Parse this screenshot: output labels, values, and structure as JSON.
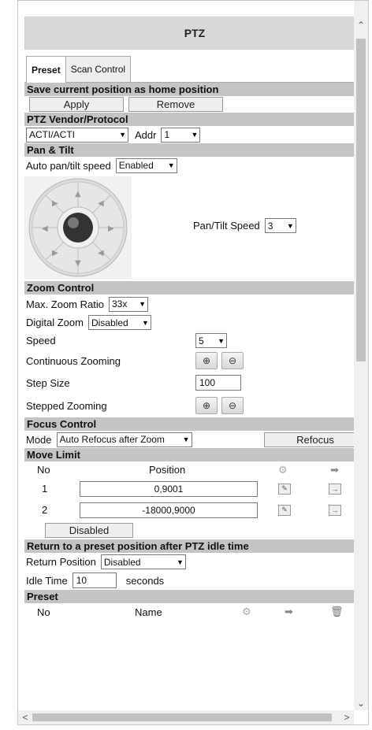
{
  "title": "PTZ",
  "tabs": [
    {
      "label": "Preset"
    },
    {
      "label": "Scan Control"
    }
  ],
  "home": {
    "header": "Save current position as home position",
    "apply": "Apply",
    "remove": "Remove"
  },
  "vendor": {
    "header": "PTZ Vendor/Protocol",
    "protocol": "ACTI/ACTI",
    "addr_label": "Addr",
    "addr": "1"
  },
  "pantilt": {
    "header": "Pan  &  Tilt",
    "auto_label": "Auto pan/tilt speed",
    "auto_value": "Enabled",
    "speed_label": "Pan/Tilt Speed",
    "speed_value": "3"
  },
  "zoom": {
    "header": "Zoom Control",
    "max_label": "Max. Zoom Ratio",
    "max_value": "33x",
    "digital_label": "Digital Zoom",
    "digital_value": "Disabled",
    "speed_label": "Speed",
    "speed_value": "5",
    "continuous_label": "Continuous Zooming",
    "step_label": "Step Size",
    "step_value": "100",
    "stepped_label": "Stepped Zooming"
  },
  "focus": {
    "header": "Focus Control",
    "mode_label": "Mode",
    "mode_value": "Auto Refocus after Zoom",
    "refocus": "Refocus"
  },
  "move_limit": {
    "header": "Move Limit",
    "col_no": "No",
    "col_position": "Position",
    "rows": [
      {
        "no": "1",
        "position": "0,9001"
      },
      {
        "no": "2",
        "position": "-18000,9000"
      }
    ],
    "disabled": "Disabled"
  },
  "return_preset": {
    "header": "Return to a preset position after PTZ idle time",
    "pos_label": "Return Position",
    "pos_value": "Disabled",
    "idle_label": "Idle Time",
    "idle_value": "10",
    "idle_unit": "seconds"
  },
  "preset": {
    "header": "Preset",
    "col_no": "No",
    "col_name": "Name"
  }
}
